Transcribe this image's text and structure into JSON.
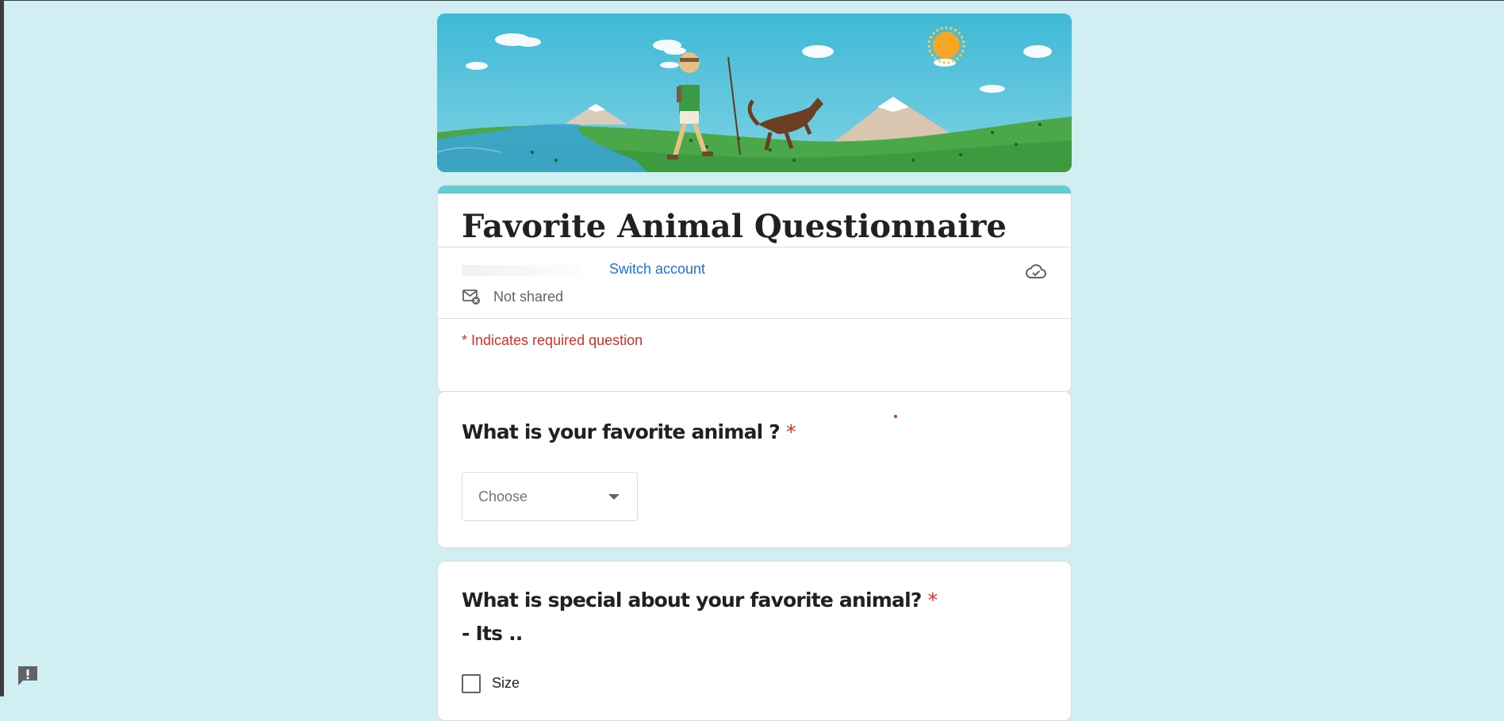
{
  "form": {
    "title": "Favorite Animal Questionnaire",
    "accent_color": "#64cdd2",
    "background_color": "#d1eef2"
  },
  "account": {
    "switch_label": "Switch account",
    "shared_status": "Not shared",
    "shared_icon": "mail-off-icon",
    "save_icon": "cloud-check-icon"
  },
  "required_note": "* Indicates required question",
  "questions": [
    {
      "title": "What is your favorite animal ?",
      "required_mark": "*",
      "type": "dropdown",
      "placeholder": "Choose",
      "icon": "dropdown-arrow-icon"
    },
    {
      "title": "What is special about your favorite animal?",
      "required_mark": "*",
      "subtitle": "- Its ..",
      "type": "checkbox",
      "options": [
        {
          "label": "Size",
          "checked": false
        }
      ]
    }
  ],
  "feedback": {
    "icon": "report-feedback-icon"
  },
  "banner": {
    "image": "hiker-with-dog-illustration"
  }
}
